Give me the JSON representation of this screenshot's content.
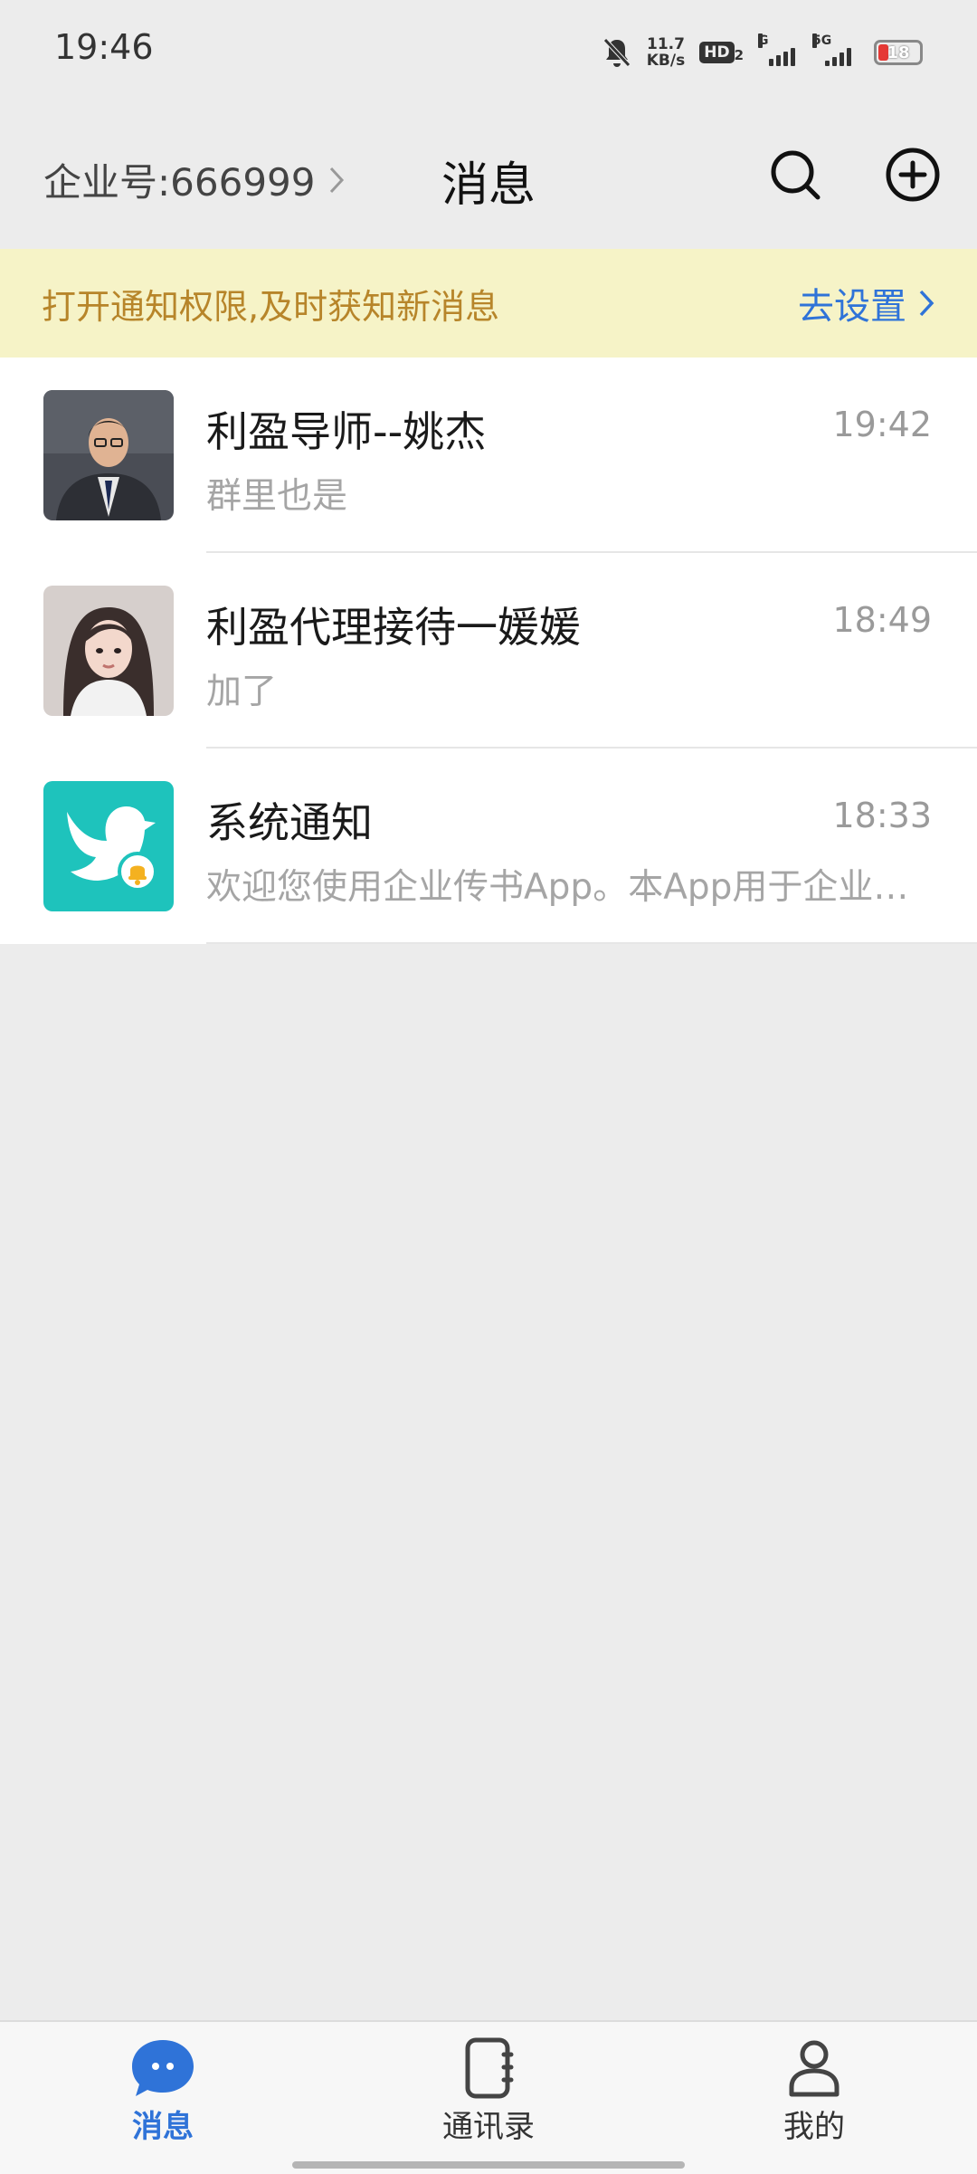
{
  "status_bar": {
    "time": "19:46",
    "net_speed_value": "11.7",
    "net_speed_unit": "KB/s",
    "hd_label": "HD",
    "hd_sub": "2",
    "signal1_label": "G",
    "signal2_label": "5G",
    "battery_level": "18",
    "icons": [
      "mute-bell-icon",
      "signal-icon",
      "battery-icon"
    ]
  },
  "header": {
    "company_label": "企业号:666999",
    "title": "消息",
    "search_icon": "search-icon",
    "add_icon": "add-circle-icon"
  },
  "notice": {
    "text": "打开通知权限,及时获知新消息",
    "action": "去设置"
  },
  "chats": [
    {
      "name": "利盈导师--姚杰",
      "time": "19:42",
      "preview": "群里也是",
      "avatar": "man-photo"
    },
    {
      "name": "利盈代理接待一媛媛",
      "time": "18:49",
      "preview": "加了",
      "avatar": "woman-photo"
    },
    {
      "name": "系统通知",
      "time": "18:33",
      "preview": "欢迎您使用企业传书App。本App用于企业内部沟通协作",
      "avatar": "dove-bell-logo"
    }
  ],
  "bottom_nav": {
    "items": [
      {
        "label": "消息",
        "icon": "chat-bubble-icon",
        "active": true
      },
      {
        "label": "通讯录",
        "icon": "contacts-book-icon",
        "active": false
      },
      {
        "label": "我的",
        "icon": "person-icon",
        "active": false
      }
    ]
  },
  "colors": {
    "accent": "#2f73d8",
    "notice_bg": "#f6f3c7",
    "notice_text": "#b7852a",
    "system_avatar_bg": "#1ec3bc",
    "background": "#ececec"
  }
}
